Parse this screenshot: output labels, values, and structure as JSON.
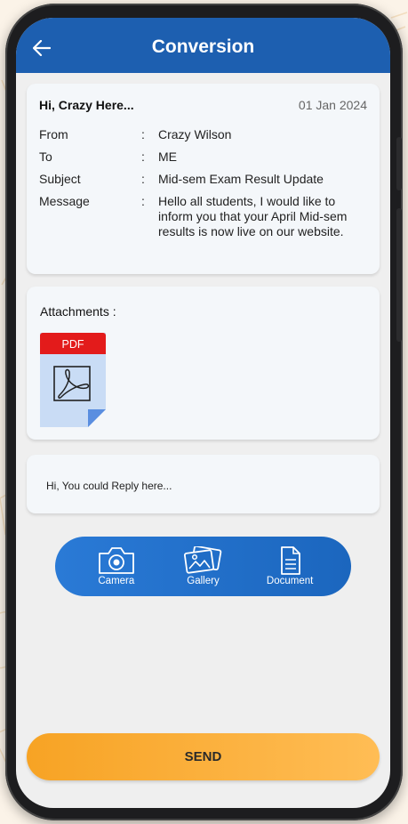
{
  "header": {
    "title": "Conversion",
    "back_icon": "arrow-left-icon"
  },
  "mail": {
    "greeting": "Hi, Crazy Here...",
    "date": "01 Jan 2024",
    "fields": [
      {
        "label": "From",
        "value": "Crazy Wilson"
      },
      {
        "label": "To",
        "value": "ME"
      },
      {
        "label": "Subject",
        "value": "Mid-sem Exam Result Update"
      },
      {
        "label": "Message",
        "value": "Hello all students, I would like to inform you that your April Mid-sem results is now live on our website."
      }
    ],
    "separator": ":"
  },
  "attachments": {
    "title": "Attachments :",
    "files": [
      {
        "type_label": "PDF",
        "icon": "pdf-file-icon"
      }
    ]
  },
  "reply": {
    "placeholder": "Hi, You could Reply here..."
  },
  "media": {
    "camera": {
      "label": "Camera",
      "icon": "camera-icon"
    },
    "gallery": {
      "label": "Gallery",
      "icon": "gallery-icon"
    },
    "document": {
      "label": "Document",
      "icon": "document-icon"
    }
  },
  "send": {
    "label": "SEND"
  },
  "colors": {
    "header": "#1d5fb0",
    "media_bar": "#2a7ad6",
    "send": "#f7a324",
    "pdf_badge": "#e31b1b",
    "pdf_body": "#c9dcf5"
  }
}
